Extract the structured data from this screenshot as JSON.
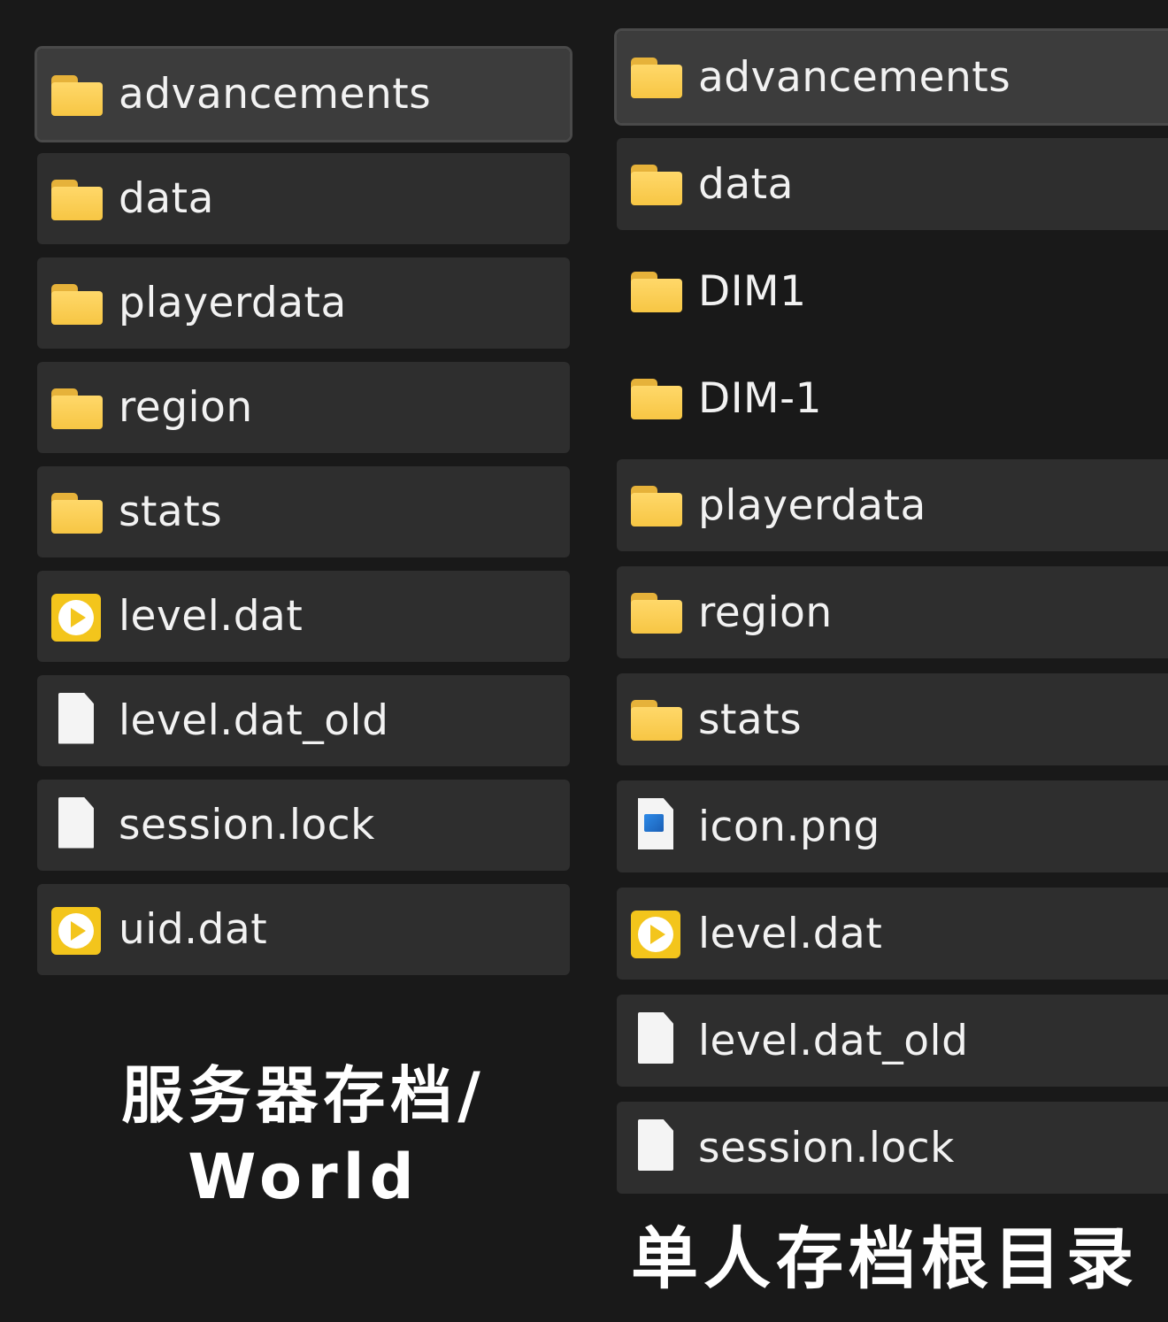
{
  "left_panel": {
    "items": [
      {
        "label": "advancements",
        "icon": "folder-icon"
      },
      {
        "label": "data",
        "icon": "folder-icon"
      },
      {
        "label": "playerdata",
        "icon": "folder-icon"
      },
      {
        "label": "region",
        "icon": "folder-icon"
      },
      {
        "label": "stats",
        "icon": "folder-icon"
      },
      {
        "label": "level.dat",
        "icon": "dat-file-icon"
      },
      {
        "label": "level.dat_old",
        "icon": "file-icon"
      },
      {
        "label": "session.lock",
        "icon": "file-icon"
      },
      {
        "label": "uid.dat",
        "icon": "dat-file-icon"
      }
    ],
    "caption_line1": "服务器存档/",
    "caption_line2": "World"
  },
  "right_panel": {
    "items": [
      {
        "label": "advancements",
        "icon": "folder-icon"
      },
      {
        "label": "data",
        "icon": "folder-icon"
      },
      {
        "label": "DIM1",
        "icon": "folder-icon"
      },
      {
        "label": "DIM-1",
        "icon": "folder-icon"
      },
      {
        "label": "playerdata",
        "icon": "folder-icon"
      },
      {
        "label": "region",
        "icon": "folder-icon"
      },
      {
        "label": "stats",
        "icon": "folder-icon"
      },
      {
        "label": "icon.png",
        "icon": "image-file-icon"
      },
      {
        "label": "level.dat",
        "icon": "dat-file-icon"
      },
      {
        "label": "level.dat_old",
        "icon": "file-icon"
      },
      {
        "label": "session.lock",
        "icon": "file-icon"
      }
    ],
    "caption": "单人存档根目录"
  },
  "colors": {
    "background": "#191919",
    "row": "#2e2e2e",
    "row_selected": "#3c3c3c",
    "folder": "#f7c644",
    "dat": "#f3c51c"
  }
}
